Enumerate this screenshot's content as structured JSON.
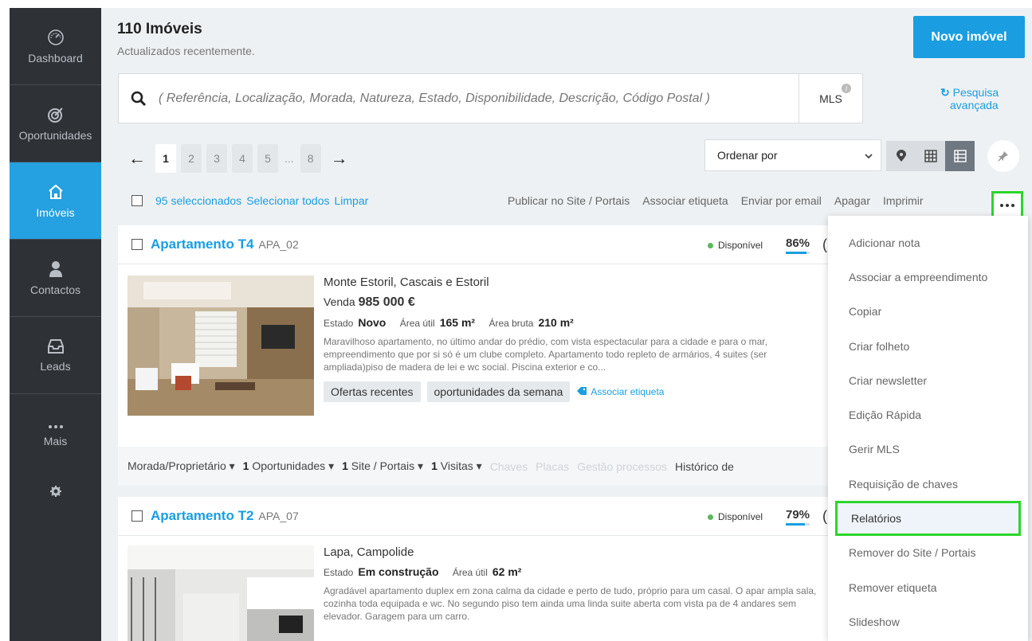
{
  "sidebar": {
    "items": [
      {
        "label": "Dashboard",
        "icon": "dashboard-gauge-icon"
      },
      {
        "label": "Oportunidades",
        "icon": "target-icon"
      },
      {
        "label": "Imóveis",
        "icon": "house-icon"
      },
      {
        "label": "Contactos",
        "icon": "person-icon"
      },
      {
        "label": "Leads",
        "icon": "inbox-icon"
      },
      {
        "label": "Mais",
        "icon": "more-dots-icon"
      }
    ],
    "settings_icon": "gear-icon"
  },
  "header": {
    "title": "110 Imóveis",
    "subtitle": "Actualizados recentemente.",
    "new_button": "Novo imóvel"
  },
  "search": {
    "placeholder": "( Referência, Localização, Morada, Natureza, Estado, Disponibilidade, Descrição, Código Postal )",
    "mls_label": "MLS",
    "mls_info": "i",
    "advanced_line1": "Pesquisa",
    "advanced_line2": "avançada"
  },
  "pagination": {
    "pages": [
      "1",
      "2",
      "3",
      "4",
      "5"
    ],
    "ellipsis": "...",
    "last": "8",
    "current": "1"
  },
  "sort": {
    "label": "Ordenar por"
  },
  "selection": {
    "selected": "95 seleccionados",
    "select_all": "Selecionar todos",
    "clear": "Limpar"
  },
  "actions": [
    "Publicar no Site / Portais",
    "Associar etiqueta",
    "Enviar por email",
    "Apagar",
    "Imprimir"
  ],
  "properties": [
    {
      "title": "Apartamento T4",
      "ref": "APA_02",
      "status": "Disponível",
      "pct": "86%",
      "pct_value": 86,
      "location": "Monte Estoril, Cascais e Estoril",
      "deal": "Venda",
      "price": "985 000 €",
      "estado_label": "Estado",
      "estado": "Novo",
      "area_util_label": "Área útil",
      "area_util": "165 m²",
      "area_bruta_label": "Área bruta",
      "area_bruta": "210 m²",
      "description": "Maravilhoso apartamento, no último andar do prédio, com vista espectacular para a cidade e para o mar, empreendimento que por si só é um clube completo. Apartamento todo repleto de armários, 4 suites (ser ampliada)piso de madera de lei e wc social. Piscina exterior e co...",
      "tags": [
        "Ofertas recentes",
        "oportunidades da semana"
      ],
      "tag_link": "Associar etiqueta",
      "footer": {
        "morada": "Morada/Proprietário",
        "oport_count": "1",
        "oport": "Oportunidades",
        "site_count": "1",
        "site": "Site / Portais",
        "visitas_count": "1",
        "visitas": "Visitas",
        "chaves": "Chaves",
        "placas": "Placas",
        "gestao": "Gestão processos",
        "historico": "Histórico de"
      }
    },
    {
      "title": "Apartamento T2",
      "ref": "APA_07",
      "status": "Disponível",
      "pct": "79%",
      "pct_value": 79,
      "location": "Lapa, Campolide",
      "estado_label": "Estado",
      "estado": "Em construção",
      "area_util_label": "Área útil",
      "area_util": "62 m²",
      "description": "Agradável apartamento duplex em zona calma da cidade e perto de tudo, próprio para um casal. O apar ampla sala, cozinha toda equipada e wc. No segundo piso tem ainda uma linda suite aberta com vista pa de 4 andares sem elevador. Garagem para um carro."
    }
  ],
  "dropdown": {
    "items": [
      "Adicionar nota",
      "Associar a empreendimento",
      "Copiar",
      "Criar folheto",
      "Criar newsletter",
      "Edição Rápida",
      "Gerir MLS",
      "Requisição de chaves",
      "Relatórios",
      "Remover do Site / Portais",
      "Remover etiqueta",
      "Slideshow"
    ],
    "highlighted": "Relatórios"
  }
}
